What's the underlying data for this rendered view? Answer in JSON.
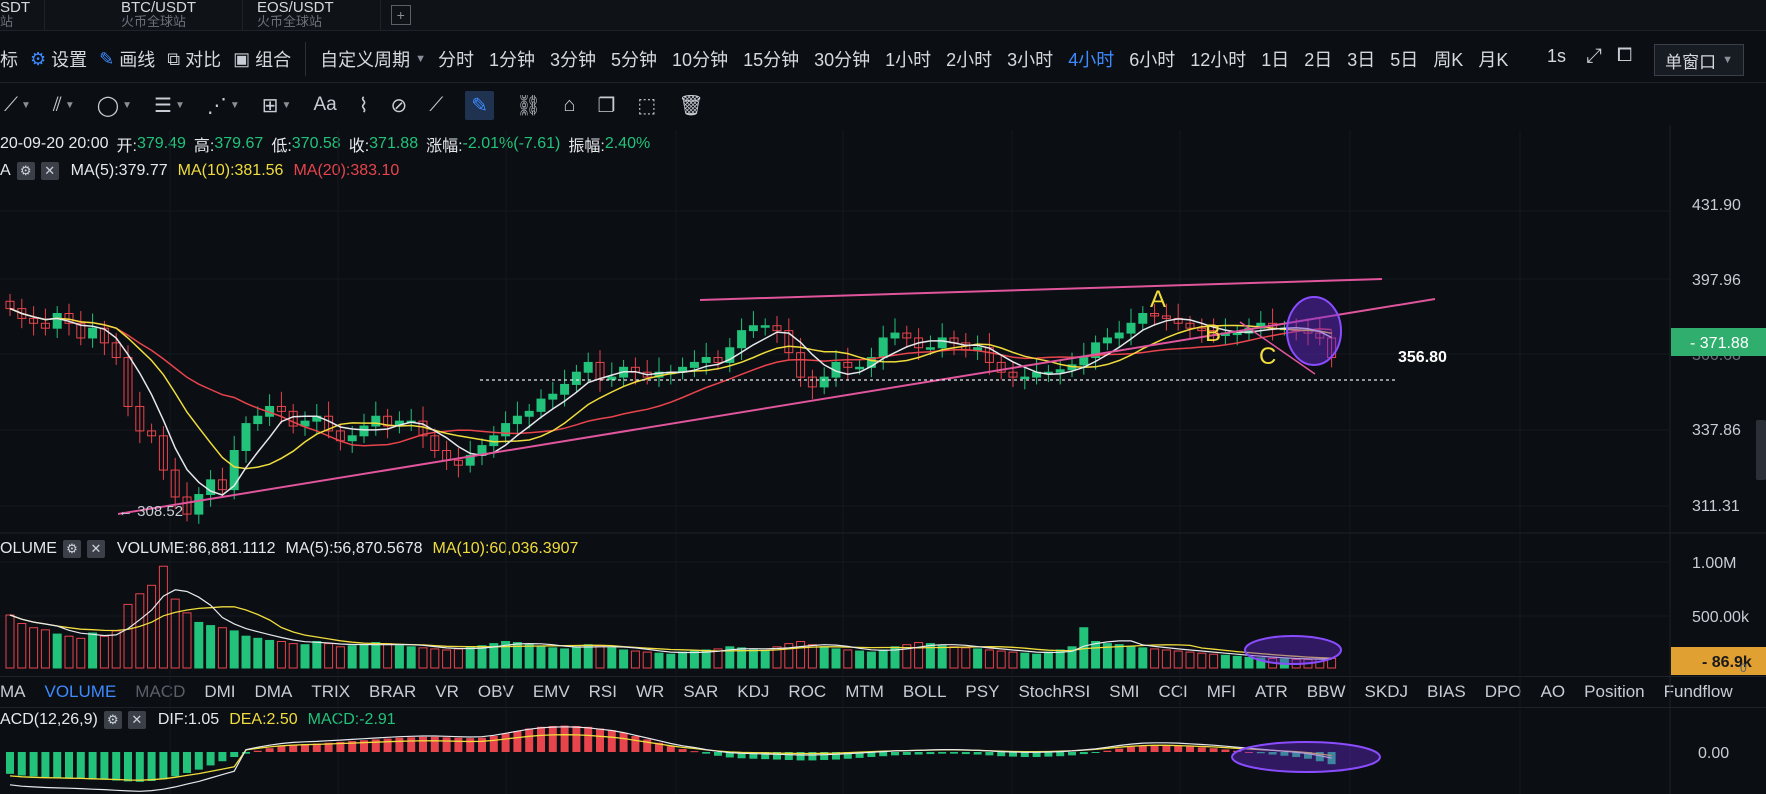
{
  "tabs": [
    {
      "pair": "SDT",
      "exchange": "站"
    },
    {
      "pair": "BTC/USDT",
      "exchange": "火币全球站"
    },
    {
      "pair": "EOS/USDT",
      "exchange": "火币全球站"
    }
  ],
  "toolbar": {
    "indicator_label": "标",
    "settings_label": "设置",
    "draw_label": "画线",
    "compare_label": "对比",
    "combine_label": "组合",
    "custom_period_label": "自定义周期",
    "periods": [
      "分时",
      "1分钟",
      "3分钟",
      "5分钟",
      "10分钟",
      "15分钟",
      "30分钟",
      "1小时",
      "2小时",
      "3小时",
      "4小时",
      "6小时",
      "12小时",
      "1日",
      "2日",
      "3日",
      "5日",
      "周K",
      "月K"
    ],
    "active_period": "4小时",
    "interval": "1s",
    "window_label": "单窗口"
  },
  "ohlc": {
    "datetime": "20-09-20 20:00",
    "open_label": "开:",
    "open": "379.49",
    "high_label": "高:",
    "high": "379.67",
    "low_label": "低:",
    "low": "370.58",
    "close_label": "收:",
    "close": "371.88",
    "change_label": "涨幅:",
    "change": "-2.01%(-7.61)",
    "amp_label": "振幅:",
    "amp": "2.40%"
  },
  "ma": {
    "prefix": "A",
    "ma5": "MA(5):379.77",
    "ma10": "MA(10):381.56",
    "ma20": "MA(20):383.10"
  },
  "volume_info": {
    "label": "OLUME",
    "volume": "VOLUME:86,881.1112",
    "ma5": "MA(5):56,870.5678",
    "ma10": "MA(10):60,036.3907"
  },
  "macd_info": {
    "label": "ACD(12,26,9)",
    "dif": "DIF:1.05",
    "dea": "DEA:2.50",
    "macd": "MACD:-2.91"
  },
  "indicator_tabs": [
    "MA",
    "VOLUME",
    "MACD",
    "DMI",
    "DMA",
    "TRIX",
    "BRAR",
    "VR",
    "OBV",
    "EMV",
    "RSI",
    "WR",
    "SAR",
    "KDJ",
    "ROC",
    "MTM",
    "BOLL",
    "PSY",
    "StochRSI",
    "SMI",
    "CCI",
    "MFI",
    "ATR",
    "BBW",
    "SKDJ",
    "BIAS",
    "DPO",
    "AO",
    "Position",
    "Fundflow"
  ],
  "colors": {
    "up": "#22c27a",
    "down": "#e8444c",
    "ma5": "#e6e8eb",
    "ma10": "#f0dc3c",
    "ma20": "#e8444c",
    "trendline": "#e0559c",
    "accent": "#3d8bff"
  },
  "chart_data": [
    {
      "type": "candlestick",
      "y_ticks": [
        "431.90",
        "397.96",
        "337.86",
        "311.31"
      ],
      "ylim": [
        300,
        440
      ],
      "current_price": "371.88",
      "hidden_tick": "366.68",
      "low_marker": "308.52",
      "support_level": "356.80",
      "support_value": 356.8,
      "wave_labels": [
        "A",
        "B",
        "C"
      ],
      "series": [
        {
          "name": "MA(5)"
        },
        {
          "name": "MA(10)"
        },
        {
          "name": "MA(20)"
        }
      ],
      "close": [
        392,
        388,
        386,
        384,
        390,
        386,
        380,
        384,
        378,
        372,
        352,
        342,
        340,
        326,
        315,
        308,
        316,
        322,
        318,
        334,
        345,
        348,
        352,
        350,
        344,
        346,
        348,
        342,
        338,
        340,
        344,
        348,
        344,
        346,
        346,
        340,
        334,
        330,
        328,
        332,
        336,
        340,
        345,
        348,
        350,
        355,
        357,
        361,
        366,
        370,
        363,
        364,
        368,
        366,
        364,
        366,
        366,
        368,
        370,
        372,
        370,
        376,
        383,
        385,
        385,
        383,
        374,
        364,
        360,
        364,
        370,
        368,
        368,
        372,
        380,
        382,
        380,
        376,
        376,
        380,
        378,
        375,
        376,
        370,
        366,
        364,
        364,
        366,
        366,
        367,
        369,
        372,
        378,
        380,
        382,
        386,
        390,
        389,
        388,
        386,
        384,
        383,
        381,
        382,
        382,
        384,
        386,
        384,
        384,
        383,
        382,
        380,
        372
      ],
      "volume": [
        500,
        420,
        380,
        360,
        320,
        300,
        280,
        330,
        300,
        350,
        600,
        700,
        780,
        960,
        650,
        520,
        430,
        400,
        380,
        350,
        300,
        280,
        260,
        250,
        230,
        220,
        250,
        230,
        200,
        210,
        220,
        240,
        230,
        210,
        200,
        190,
        180,
        170,
        180,
        200,
        210,
        230,
        250,
        240,
        220,
        200,
        190,
        180,
        200,
        220,
        210,
        190,
        170,
        160,
        150,
        140,
        130,
        150,
        160,
        170,
        180,
        200,
        190,
        170,
        160,
        200,
        230,
        250,
        220,
        200,
        180,
        170,
        160,
        150,
        170,
        200,
        220,
        240,
        230,
        210,
        200,
        190,
        180,
        170,
        160,
        150,
        140,
        130,
        150,
        170,
        200,
        380,
        250,
        230,
        220,
        200,
        190,
        180,
        170,
        160,
        150,
        140,
        130,
        120,
        110,
        100,
        95,
        90,
        85,
        80,
        80,
        85,
        90
      ],
      "macd": [
        -5.2,
        -5.6,
        -5.8,
        -6.0,
        -6.1,
        -6.2,
        -6.3,
        -6.5,
        -6.6,
        -6.8,
        -7.0,
        -7.1,
        -6.9,
        -6.5,
        -5.8,
        -5.0,
        -4.2,
        -3.2,
        -2.2,
        -1.2,
        -0.4,
        0.3,
        0.9,
        1.4,
        1.7,
        1.9,
        2.0,
        2.2,
        2.4,
        2.6,
        2.8,
        3.0,
        3.2,
        3.4,
        3.5,
        3.6,
        3.6,
        3.5,
        3.4,
        3.3,
        3.4,
        3.8,
        4.4,
        5.0,
        5.6,
        6.0,
        6.2,
        6.3,
        6.2,
        6.0,
        5.6,
        5.2,
        4.6,
        3.8,
        3.0,
        2.2,
        1.4,
        0.7,
        0.2,
        -0.4,
        -0.9,
        -1.3,
        -1.5,
        -1.6,
        -1.7,
        -1.8,
        -1.9,
        -2.0,
        -2.0,
        -1.9,
        -1.8,
        -1.6,
        -1.4,
        -1.2,
        -1.0,
        -0.8,
        -0.7,
        -0.6,
        -0.5,
        -0.4,
        -0.4,
        -0.5,
        -0.6,
        -0.8,
        -1.0,
        -1.1,
        -1.2,
        -1.2,
        -1.1,
        -1.0,
        -0.8,
        -0.5,
        -0.2,
        0.3,
        0.8,
        1.2,
        1.5,
        1.6,
        1.6,
        1.5,
        1.3,
        1.1,
        0.9,
        0.6,
        0.3,
        0.0,
        -0.3,
        -0.6,
        -0.9,
        -1.2,
        -1.6,
        -2.2,
        -2.9
      ]
    },
    {
      "type": "bar",
      "y_ticks": [
        "1.00M",
        "500.00k"
      ],
      "current_volume": "86.9k",
      "current_volume_tick": "0"
    },
    {
      "type": "bar",
      "y_ticks": [
        "0.00"
      ]
    }
  ]
}
